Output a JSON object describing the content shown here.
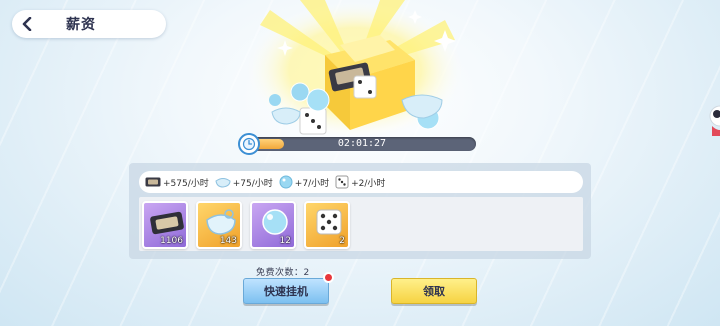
{
  "header": {
    "title": "薪资"
  },
  "progress": {
    "time": "02:01:27",
    "fraction": 0.16
  },
  "rates": [
    {
      "icon": "videotape-icon",
      "text": "+575/小时"
    },
    {
      "icon": "whistle-icon",
      "text": "+75/小时"
    },
    {
      "icon": "bubble-icon",
      "text": "+7/小时"
    },
    {
      "icon": "dice-icon",
      "text": "+2/小时"
    }
  ],
  "items": [
    {
      "icon": "videotape-icon",
      "count": "1106",
      "frame": "purple"
    },
    {
      "icon": "whistle-icon",
      "count": "143",
      "frame": "gold"
    },
    {
      "icon": "bubble-icon",
      "count": "12",
      "frame": "purple"
    },
    {
      "icon": "dice-icon",
      "count": "2",
      "frame": "gold"
    }
  ],
  "free": {
    "text": "免费次数：2"
  },
  "buttons": {
    "quick": "快速挂机",
    "claim": "领取"
  },
  "colors": {
    "progress_fill": "#f2a83a",
    "quick_btn": "#7cc0f0",
    "claim_btn": "#f6d343",
    "notify_dot": "#e8373c"
  }
}
